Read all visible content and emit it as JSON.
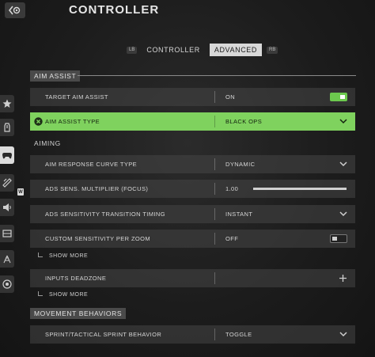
{
  "header": {
    "title": "CONTROLLER"
  },
  "tabs": {
    "left_hint": "LB",
    "right_hint": "RB",
    "items": [
      {
        "label": "CONTROLLER",
        "active": false
      },
      {
        "label": "ADVANCED",
        "active": true
      }
    ]
  },
  "sidebar": {
    "items": [
      {
        "icon": "star-icon"
      },
      {
        "icon": "controller-trigger-icon"
      },
      {
        "icon": "gamepad-icon",
        "active": true
      },
      {
        "icon": "interface-icon"
      },
      {
        "icon": "speaker-icon"
      },
      {
        "icon": "display-icon"
      },
      {
        "icon": "network-icon"
      },
      {
        "icon": "account-icon"
      }
    ],
    "badge": "W"
  },
  "sections": {
    "aim_assist": "AIM ASSIST",
    "aiming": "AIMING",
    "movement": "MOVEMENT BEHAVIORS"
  },
  "rows": {
    "target_aim_assist": {
      "label": "TARGET AIM ASSIST",
      "value": "ON",
      "toggle": "on"
    },
    "aim_assist_type": {
      "label": "AIM ASSIST TYPE",
      "value": "BLACK OPS"
    },
    "response_curve": {
      "label": "AIM RESPONSE CURVE TYPE",
      "value": "DYNAMIC"
    },
    "ads_multiplier": {
      "label": "ADS SENS. MULTIPLIER (FOCUS)",
      "value": "1.00",
      "slider_fraction": 1.0
    },
    "ads_transition": {
      "label": "ADS SENSITIVITY TRANSITION TIMING",
      "value": "INSTANT"
    },
    "custom_per_zoom": {
      "label": "CUSTOM SENSITIVITY PER ZOOM",
      "value": "OFF",
      "toggle": "off"
    },
    "show_more_1": "SHOW MORE",
    "inputs_deadzone": {
      "label": "INPUTS DEADZONE"
    },
    "show_more_2": "SHOW MORE",
    "sprint_behavior": {
      "label": "SPRINT/TACTICAL SPRINT BEHAVIOR",
      "value": "TOGGLE"
    }
  },
  "colors": {
    "accent": "#7fd25e",
    "toggle_on": "#6cc94e"
  }
}
